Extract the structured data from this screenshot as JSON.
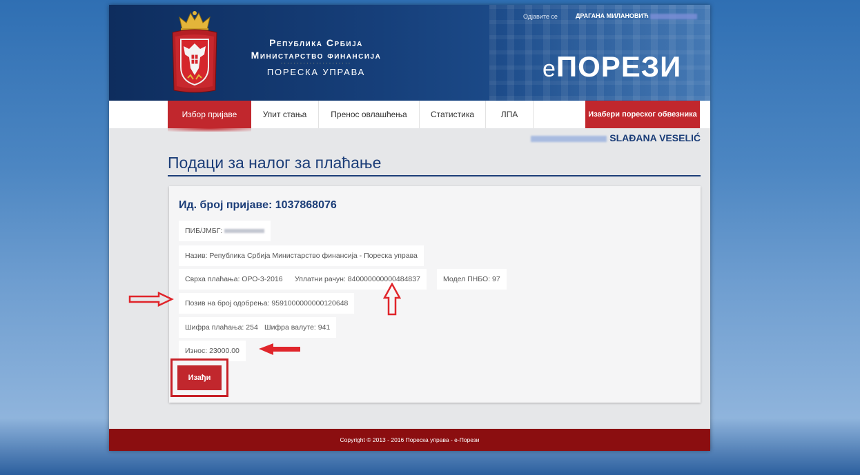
{
  "header": {
    "org_line1": "Република Србија",
    "org_line2": "Министарство финансија",
    "org_dots": "······················",
    "org_line3": "ПОРЕСКА УПРАВА",
    "brand_e": "е",
    "brand_rest": "ПОРЕЗИ",
    "logout_label": "Одјавите се",
    "user_name": "ДРАГАНА МИЛАНОВИЋ"
  },
  "nav": {
    "items": [
      "Избор пријаве",
      "Упит стања",
      "Пренос овлашћења",
      "Статистика",
      "ЛПА"
    ],
    "cta": "Изабери пореског обвезника"
  },
  "taxpayer_name": "SLAĐANA VESELIĆ",
  "page_title": "Подаци за налог за плаћање",
  "panel": {
    "heading": "Ид. број пријаве: 1037868076",
    "pib_label": "ПИБ/ЈМБГ:",
    "naziv": "Назив: Република Србија Министарство финансија - Пореска управа",
    "svrha": "Сврха плаћања: ОРО-3-2016",
    "racun": "Уплатни рачун: 840000000000484837",
    "model": "Модел ПНБО: 97",
    "poziv": "Позив на број одобрења: 9591000000000120648",
    "sifra_placanja": "Шифра плаћања: 254",
    "sifra_valute": "Шифра валуте: 941",
    "iznos": "Износ: 23000.00",
    "exit_button": "Изађи"
  },
  "footer": "Copyright © 2013 - 2016 Пореска управа - е-Порези",
  "colors": {
    "accent_red": "#c1272d",
    "navy": "#1b3d78",
    "footer_red": "#8b0e10"
  },
  "icons": [
    "serbian-coat-of-arms",
    "annotation-arrow-right",
    "annotation-arrow-up",
    "annotation-arrow-left"
  ]
}
